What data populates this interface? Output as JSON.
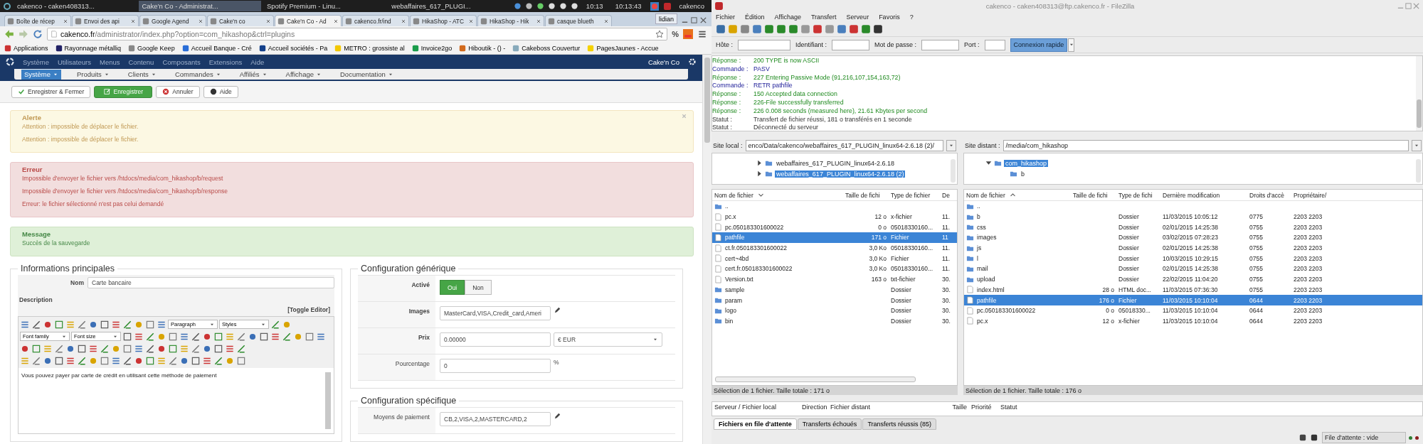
{
  "taskbar": {
    "windows": [
      {
        "label": "cakenco - caken408313...",
        "selected": false
      },
      {
        "label": "Cake'n Co - Administrat...",
        "selected": true
      },
      {
        "label": "Spotify Premium - Linu...",
        "selected": false
      },
      {
        "label": "webaffaires_617_PLUGI...",
        "selected": false
      }
    ],
    "time": "10:13",
    "clock": "10:13:43",
    "user": "cakenco"
  },
  "browser": {
    "tabs": [
      {
        "label": "Boîte de récep",
        "selected": false
      },
      {
        "label": "Envoi des api",
        "selected": false
      },
      {
        "label": "Google Agend",
        "selected": false
      },
      {
        "label": "Cake'n co",
        "selected": false
      },
      {
        "label": "Cake'n Co - Ad",
        "selected": true
      },
      {
        "label": "cakenco.fr/ind",
        "selected": false
      },
      {
        "label": "HikaShop - ATC",
        "selected": false
      },
      {
        "label": "HikaShop - Hik",
        "selected": false
      },
      {
        "label": "casque blueth",
        "selected": false
      }
    ],
    "profile": "lidian",
    "url_host": "cakenco.fr",
    "url_path": "/administrator/index.php?option=com_hikashop&ctrl=plugins",
    "extension_label": "%",
    "bookmarks": [
      "Applications",
      "Rayonnage métalliq",
      "Google Keep",
      "Accueil Banque - Cré",
      "Accueil sociétés - Pa",
      "METRO : grossiste al",
      "Invoice2go",
      "Hiboutik - () -",
      "Cakeboss Couvertur",
      "PagesJaunes - Accue"
    ]
  },
  "admin_menu": {
    "items": [
      "Système",
      "Utilisateurs",
      "Menus",
      "Contenu",
      "Composants",
      "Extensions",
      "Aide"
    ],
    "site": "Cake'n Co"
  },
  "hikashop_menu": {
    "items": [
      {
        "label": "Système",
        "selected": true
      },
      {
        "label": "Produits",
        "selected": false
      },
      {
        "label": "Clients",
        "selected": false
      },
      {
        "label": "Commandes",
        "selected": false
      },
      {
        "label": "Affiliés",
        "selected": false
      },
      {
        "label": "Affichage",
        "selected": false
      },
      {
        "label": "Documentation",
        "selected": false
      }
    ]
  },
  "toolbar": {
    "buttons": [
      {
        "kind": "save-close",
        "label": "Enregistrer & Fermer"
      },
      {
        "kind": "save",
        "label": "Enregistrer"
      },
      {
        "kind": "cancel",
        "label": "Annuler"
      },
      {
        "kind": "help",
        "label": "Aide"
      }
    ]
  },
  "alerts": [
    {
      "kind": "warning",
      "title": "Alerte",
      "closable": true,
      "messages": [
        "Attention : impossible de déplacer le fichier.",
        "Attention : impossible de déplacer le fichier."
      ]
    },
    {
      "kind": "error",
      "title": "Erreur",
      "closable": false,
      "messages": [
        "Impossible d'envoyer le fichier vers /htdocs/media/com_hikashop/b/request",
        "Impossible d'envoyer le fichier vers /htdocs/media/com_hikashop/b/response",
        "Erreur: le fichier sélectionné n'est pas celui demandé"
      ]
    },
    {
      "kind": "success",
      "title": "Message",
      "closable": false,
      "messages": [
        "Succès de la sauvegarde"
      ]
    }
  ],
  "main_info": {
    "legend": "Informations principales",
    "name_label": "Nom",
    "name_value": "Carte bancaire",
    "description_label": "Description",
    "toggle_editor": "[Toggle Editor]",
    "format_selects": [
      "Paragraph",
      "Styles"
    ],
    "font_selects": [
      "Font family",
      "Font size"
    ],
    "content": "Vous pouvez payer par carte de crédit en utilisant cette méthode de paiement"
  },
  "generic_config": {
    "legend": "Configuration générique",
    "rows": [
      {
        "kind": "toggle",
        "label": "Activé",
        "bold": true,
        "options": [
          {
            "label": "Oui",
            "selected": true
          },
          {
            "label": "Non",
            "selected": false
          }
        ]
      },
      {
        "kind": "text-edit",
        "label": "Images",
        "bold": true,
        "value": "MasterCard,VISA,Credit_card,Ameri"
      },
      {
        "kind": "price",
        "label": "Prix",
        "bold": true,
        "value": "0.00000",
        "currency": "€ EUR"
      },
      {
        "kind": "percent",
        "label": "Pourcentage",
        "bold": false,
        "value": "0",
        "suffix": "%"
      }
    ]
  },
  "specific_config": {
    "legend": "Configuration spécifique",
    "rows": [
      {
        "kind": "text-edit",
        "label": "Moyens de paiement",
        "bold": false,
        "value": "CB,2,VISA,2,MASTERCARD,2"
      }
    ]
  },
  "filezilla": {
    "title": "cakenco - caken408313@ftp.cakenco.fr - FileZilla",
    "menu": [
      "Fichier",
      "Édition",
      "Affichage",
      "Transfert",
      "Serveur",
      "Favoris",
      "?"
    ],
    "quickconnect": {
      "host_label": "Hôte :",
      "user_label": "Identifiant :",
      "password_label": "Mot de passe :",
      "port_label": "Port :",
      "button": "Connexion rapide"
    },
    "log": [
      {
        "kind": "response",
        "prefix": "Réponse :",
        "text": "200 TYPE is now ASCII"
      },
      {
        "kind": "command",
        "prefix": "Commande :",
        "text": "PASV"
      },
      {
        "kind": "response",
        "prefix": "Réponse :",
        "text": "227 Entering Passive Mode (91,216,107,154,163,72)"
      },
      {
        "kind": "command",
        "prefix": "Commande :",
        "text": "RETR pathfile"
      },
      {
        "kind": "response",
        "prefix": "Réponse :",
        "text": "150 Accepted data connection"
      },
      {
        "kind": "response",
        "prefix": "Réponse :",
        "text": "226-File successfully transferred"
      },
      {
        "kind": "response",
        "prefix": "Réponse :",
        "text": "226 0.008 seconds (measured here), 21.61 Kbytes per second"
      },
      {
        "kind": "status",
        "prefix": "Statut :",
        "text": "Transfert de fichier réussi, 181 o transférés en 1 seconde"
      },
      {
        "kind": "status",
        "prefix": "Statut :",
        "text": "Déconnecté du serveur"
      }
    ],
    "local": {
      "site_label": "Site local :",
      "path": "enco/Data/cakenco/webaffaires_617_PLUGIN_linux64-2.6.18 (2)/",
      "tree": [
        {
          "label": "webaffaires_617_PLUGIN_linux64-2.6.18",
          "expanded": false,
          "selected": false
        },
        {
          "label": "webaffaires_617_PLUGIN_linux64-2.6.18 (2)",
          "expanded": false,
          "selected": true
        }
      ],
      "sort_descending": true,
      "columns": [
        {
          "label": "Nom de fichier",
          "sorted": true
        },
        {
          "label": "Taille de fichi",
          "sorted": false
        },
        {
          "label": "Type de fichier",
          "sorted": false
        },
        {
          "label": "De",
          "sorted": false
        }
      ],
      "rows": [
        {
          "kind": "parent",
          "name": "..",
          "selected": false
        },
        {
          "kind": "file",
          "name": "pc.x",
          "size": "12 o",
          "type": "x-fichier",
          "column_4": "11.",
          "selected": false
        },
        {
          "kind": "file",
          "name": "pc.050183301600022",
          "size": "0 o",
          "type": "05018330160...",
          "column_4": "11.",
          "selected": false
        },
        {
          "kind": "file",
          "name": "pathfile",
          "size": "171 o",
          "type": "Fichier",
          "column_4": "11",
          "selected": true
        },
        {
          "kind": "file",
          "name": "ct.fr.050183301600022",
          "size": "3,0 Ko",
          "type": "05018330160...",
          "column_4": "11.",
          "selected": false
        },
        {
          "kind": "file",
          "name": "cert~4bd",
          "size": "3,0 Ko",
          "type": "Fichier",
          "column_4": "11.",
          "selected": false
        },
        {
          "kind": "file",
          "name": "cert.fr.050183301600022",
          "size": "3,0 Ko",
          "type": "05018330160...",
          "column_4": "11.",
          "selected": false
        },
        {
          "kind": "file",
          "name": "Version.txt",
          "size": "163 o",
          "type": "txt-fichier",
          "column_4": "30.",
          "selected": false
        },
        {
          "kind": "folder",
          "name": "sample",
          "type": "Dossier",
          "column_4": "30.",
          "selected": false
        },
        {
          "kind": "folder",
          "name": "param",
          "type": "Dossier",
          "column_4": "30.",
          "selected": false
        },
        {
          "kind": "folder",
          "name": "logo",
          "type": "Dossier",
          "column_4": "30.",
          "selected": false
        },
        {
          "kind": "folder",
          "name": "bin",
          "type": "Dossier",
          "column_4": "30.",
          "selected": false
        }
      ],
      "status": "Sélection de 1 fichier. Taille totale : 171 o"
    },
    "remote": {
      "site_label": "Site distant :",
      "path": "/media/com_hikashop",
      "tree": [
        {
          "label": "com_hikashop",
          "expanded": true,
          "selected": true,
          "children": [
            {
              "label": "b",
              "selected": false
            }
          ]
        }
      ],
      "sort_descending": false,
      "columns": [
        {
          "label": "Nom de fichier",
          "sorted": true
        },
        {
          "label": "Taille de fichi",
          "sorted": false
        },
        {
          "label": "Type de fichi",
          "sorted": false
        },
        {
          "label": "Dernière modification",
          "sorted": false
        },
        {
          "label": "Droits d'accè",
          "sorted": false
        },
        {
          "label": "Propriétaire/",
          "sorted": false
        }
      ],
      "rows": [
        {
          "kind": "parent",
          "name": "..",
          "selected": false
        },
        {
          "kind": "folder",
          "name": "b",
          "type": "Dossier",
          "modified": "11/03/2015 10:05:12",
          "permissions": "0775",
          "owner": "2203 2203",
          "selected": false
        },
        {
          "kind": "folder",
          "name": "css",
          "type": "Dossier",
          "modified": "02/01/2015 14:25:38",
          "permissions": "0755",
          "owner": "2203 2203",
          "selected": false
        },
        {
          "kind": "folder",
          "name": "images",
          "type": "Dossier",
          "modified": "03/02/2015 07:28:23",
          "permissions": "0755",
          "owner": "2203 2203",
          "selected": false
        },
        {
          "kind": "folder",
          "name": "js",
          "type": "Dossier",
          "modified": "02/01/2015 14:25:38",
          "permissions": "0755",
          "owner": "2203 2203",
          "selected": false
        },
        {
          "kind": "folder",
          "name": "l",
          "type": "Dossier",
          "modified": "10/03/2015 10:29:15",
          "permissions": "0755",
          "owner": "2203 2203",
          "selected": false
        },
        {
          "kind": "folder",
          "name": "mail",
          "type": "Dossier",
          "modified": "02/01/2015 14:25:38",
          "permissions": "0755",
          "owner": "2203 2203",
          "selected": false
        },
        {
          "kind": "folder",
          "name": "upload",
          "type": "Dossier",
          "modified": "22/02/2015 11:04:20",
          "permissions": "0755",
          "owner": "2203 2203",
          "selected": false
        },
        {
          "kind": "file",
          "name": "index.html",
          "size": "28 o",
          "type": "HTML doc...",
          "modified": "11/03/2015 07:36:30",
          "permissions": "0755",
          "owner": "2203 2203",
          "selected": false
        },
        {
          "kind": "file",
          "name": "pathfile",
          "size": "176 o",
          "type": "Fichier",
          "modified": "11/03/2015 10:10:04",
          "permissions": "0644",
          "owner": "2203 2203",
          "selected": true
        },
        {
          "kind": "file",
          "name": "pc.050183301600022",
          "size": "0 o",
          "type": "05018330...",
          "modified": "11/03/2015 10:10:04",
          "permissions": "0644",
          "owner": "2203 2203",
          "selected": false
        },
        {
          "kind": "file",
          "name": "pc.x",
          "size": "12 o",
          "type": "x-fichier",
          "modified": "11/03/2015 10:10:04",
          "permissions": "0644",
          "owner": "2203 2203",
          "selected": false
        }
      ],
      "status": "Sélection de 1 fichier. Taille totale : 176 o"
    },
    "queue": {
      "columns": [
        "Serveur / Fichier local",
        "Direction",
        "Fichier distant",
        "Taille",
        "Priorité",
        "Statut"
      ],
      "tabs": [
        {
          "label": "Fichiers en file d'attente",
          "selected": true
        },
        {
          "label": "Transferts échoués",
          "selected": false
        },
        {
          "label": "Transferts réussis (85)",
          "selected": false
        }
      ],
      "status": "File d'attente : vide"
    }
  }
}
